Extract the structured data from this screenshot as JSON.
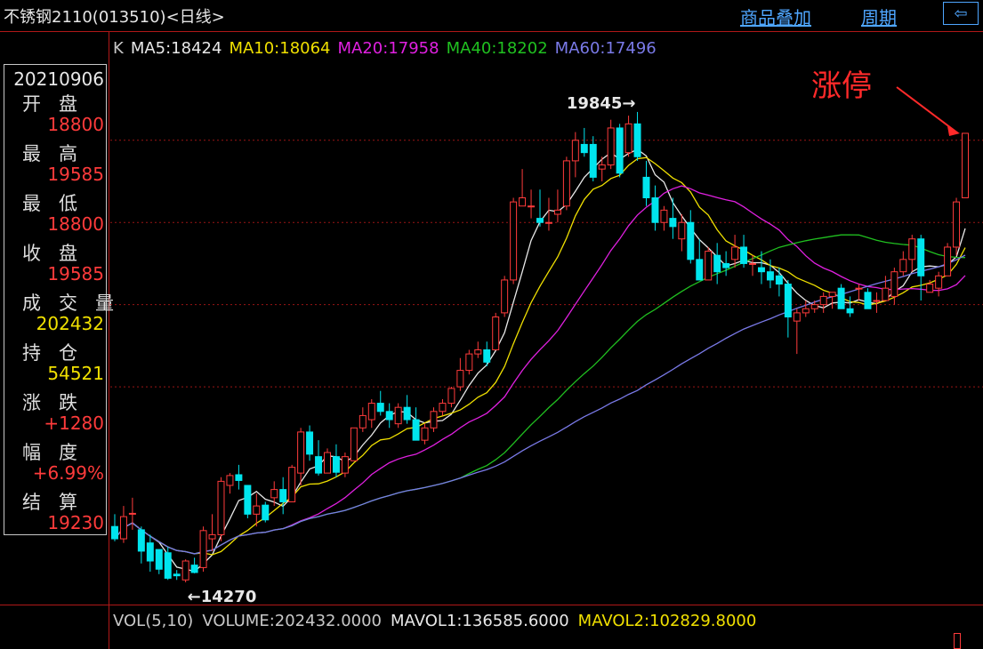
{
  "header": {
    "title": "不锈钢2110(013510)<日线>",
    "overlay_link": "商品叠加",
    "period_link": "周期",
    "back_icon_glyph": "⇦"
  },
  "ma_legend": {
    "prefix": "K",
    "items": [
      {
        "label": "MA5:18424",
        "color": "#e8e8e8"
      },
      {
        "label": "MA10:18064",
        "color": "#f0e000"
      },
      {
        "label": "MA20:17958",
        "color": "#e020e0"
      },
      {
        "label": "MA40:18202",
        "color": "#20c020"
      },
      {
        "label": "MA60:17496",
        "color": "#7a7ae8"
      }
    ]
  },
  "info_panel": {
    "date": "20210906",
    "rows": [
      {
        "label": "开盘",
        "value": "18800",
        "color": "#ff3b3b"
      },
      {
        "label": "最高",
        "value": "19585",
        "color": "#ff3b3b"
      },
      {
        "label": "最低",
        "value": "18800",
        "color": "#ff3b3b"
      },
      {
        "label": "收盘",
        "value": "19585",
        "color": "#ff3b3b"
      },
      {
        "label": "成交量",
        "value": "202432",
        "color": "#f0e000"
      },
      {
        "label": "持仓",
        "value": "54521",
        "color": "#f0e000"
      },
      {
        "label": "涨跌",
        "value": "+1280",
        "color": "#ff3b3b"
      },
      {
        "label": "幅度",
        "value": "+6.99%",
        "color": "#ff3b3b"
      },
      {
        "label": "结算",
        "value": "19230",
        "color": "#ff3b3b"
      }
    ]
  },
  "chart_data": {
    "type": "candlestick",
    "ylim": [
      13850,
      20450
    ],
    "gridlines": [
      19500,
      18500,
      17500,
      16500
    ],
    "colors": {
      "up": "#ff3b3b",
      "down": "#00e5ee",
      "ma5": "#e8e8e8",
      "ma10": "#f0e000",
      "ma20": "#e020e0",
      "ma40": "#20c020",
      "ma60": "#7a7ae8"
    },
    "candles": [
      [
        14800,
        14950,
        14620,
        14650
      ],
      [
        14650,
        15050,
        14600,
        14920
      ],
      [
        14960,
        15150,
        14760,
        14960
      ],
      [
        14760,
        14800,
        14350,
        14500
      ],
      [
        14600,
        14700,
        14250,
        14380
      ],
      [
        14520,
        14520,
        14220,
        14280
      ],
      [
        14480,
        14550,
        14150,
        14170
      ],
      [
        14220,
        14270,
        14150,
        14200
      ],
      [
        14150,
        14400,
        14120,
        14380
      ],
      [
        14330,
        14420,
        14230,
        14240
      ],
      [
        14300,
        14800,
        14250,
        14750
      ],
      [
        14650,
        14950,
        14500,
        14700
      ],
      [
        14700,
        15400,
        14620,
        15350
      ],
      [
        15300,
        15450,
        15200,
        15420
      ],
      [
        15430,
        15550,
        15250,
        15360
      ],
      [
        15300,
        15300,
        14900,
        14950
      ],
      [
        14950,
        15200,
        14800,
        15050
      ],
      [
        15060,
        15100,
        14850,
        14880
      ],
      [
        15150,
        15350,
        15050,
        15250
      ],
      [
        15250,
        15400,
        14950,
        15100
      ],
      [
        15100,
        15550,
        15100,
        15520
      ],
      [
        15450,
        16000,
        15300,
        15950
      ],
      [
        15950,
        16030,
        15600,
        15680
      ],
      [
        15650,
        15850,
        15420,
        15450
      ],
      [
        15450,
        15750,
        15450,
        15700
      ],
      [
        15650,
        15800,
        15400,
        15460
      ],
      [
        15450,
        15700,
        15400,
        15650
      ],
      [
        15600,
        16000,
        15600,
        16000
      ],
      [
        16000,
        16250,
        15950,
        16150
      ],
      [
        16100,
        16350,
        16000,
        16300
      ],
      [
        16300,
        16450,
        16150,
        16200
      ],
      [
        16200,
        16300,
        16000,
        16100
      ],
      [
        16050,
        16300,
        16000,
        16250
      ],
      [
        16250,
        16400,
        16050,
        16100
      ],
      [
        16100,
        16250,
        15850,
        15850
      ],
      [
        15850,
        16050,
        15800,
        16000
      ],
      [
        16000,
        16250,
        15950,
        16200
      ],
      [
        16200,
        16350,
        16150,
        16300
      ],
      [
        16300,
        16500,
        16250,
        16480
      ],
      [
        16500,
        16850,
        16450,
        16700
      ],
      [
        16700,
        16950,
        16650,
        16900
      ],
      [
        16900,
        17050,
        16850,
        16950
      ],
      [
        16950,
        17050,
        16750,
        16800
      ],
      [
        16950,
        17400,
        16950,
        17350
      ],
      [
        17400,
        17850,
        17350,
        17800
      ],
      [
        17800,
        18800,
        17750,
        18750
      ],
      [
        18700,
        19150,
        18700,
        18800
      ],
      [
        18700,
        18900,
        18550,
        18700
      ],
      [
        18550,
        18900,
        18450,
        18500
      ],
      [
        18500,
        18800,
        18400,
        18500
      ],
      [
        18600,
        18900,
        18500,
        18650
      ],
      [
        18700,
        19300,
        18650,
        19250
      ],
      [
        19250,
        19600,
        19050,
        19500
      ],
      [
        19450,
        19650,
        19300,
        19350
      ],
      [
        19450,
        19550,
        19000,
        19050
      ],
      [
        19150,
        19300,
        19000,
        19200
      ],
      [
        19200,
        19750,
        19150,
        19650
      ],
      [
        19650,
        19700,
        19050,
        19100
      ],
      [
        19350,
        19800,
        19300,
        19700
      ],
      [
        19700,
        19845,
        19250,
        19300
      ],
      [
        19050,
        19250,
        18700,
        18800
      ],
      [
        18800,
        18950,
        18400,
        18500
      ],
      [
        18500,
        18700,
        18400,
        18650
      ],
      [
        18550,
        18800,
        18300,
        18450
      ],
      [
        18300,
        18600,
        18150,
        18500
      ],
      [
        18500,
        18650,
        18000,
        18050
      ],
      [
        18050,
        18300,
        17800,
        17800
      ],
      [
        17800,
        18200,
        17800,
        18150
      ],
      [
        18100,
        18250,
        17750,
        17900
      ],
      [
        18000,
        18150,
        17850,
        17950
      ],
      [
        18050,
        18350,
        17950,
        18200
      ],
      [
        18200,
        18350,
        17950,
        18000
      ],
      [
        18000,
        18100,
        17850,
        18000
      ],
      [
        17950,
        18150,
        17750,
        17900
      ],
      [
        17900,
        18050,
        17700,
        17800
      ],
      [
        17850,
        17950,
        17600,
        17750
      ],
      [
        17750,
        17800,
        17100,
        17350
      ],
      [
        17300,
        17450,
        16900,
        17400
      ],
      [
        17400,
        17550,
        17350,
        17450
      ],
      [
        17450,
        17550,
        17400,
        17500
      ],
      [
        17500,
        17650,
        17400,
        17600
      ],
      [
        17600,
        17650,
        17450,
        17650
      ],
      [
        17700,
        17750,
        17450,
        17450
      ],
      [
        17450,
        17600,
        17350,
        17400
      ],
      [
        17700,
        17750,
        17550,
        17700
      ],
      [
        17650,
        17700,
        17450,
        17450
      ],
      [
        17550,
        17650,
        17400,
        17550
      ],
      [
        17550,
        17850,
        17550,
        17700
      ],
      [
        17600,
        17950,
        17500,
        17900
      ],
      [
        17900,
        18150,
        17850,
        18050
      ],
      [
        18050,
        18350,
        17900,
        18300
      ],
      [
        18300,
        18350,
        17550,
        17850
      ],
      [
        17650,
        17800,
        17650,
        17750
      ],
      [
        17700,
        17900,
        17600,
        17850
      ],
      [
        17850,
        18250,
        17850,
        18200
      ],
      [
        18200,
        18800,
        18100,
        18750
      ],
      [
        18800,
        19585,
        18800,
        19585
      ]
    ],
    "annotations": {
      "high_label": "19845→",
      "low_label": "←14270",
      "limit_up_label": "涨停"
    }
  },
  "volume_legend": {
    "items": [
      {
        "label": "VOL(5,10)",
        "color": "#c8c8c8"
      },
      {
        "label": "VOLUME:202432.0000",
        "color": "#c8c8c8"
      },
      {
        "label": "MAVOL1:136585.6000",
        "color": "#e8e8e8"
      },
      {
        "label": "MAVOL2:102829.8000",
        "color": "#f0e000"
      }
    ]
  }
}
